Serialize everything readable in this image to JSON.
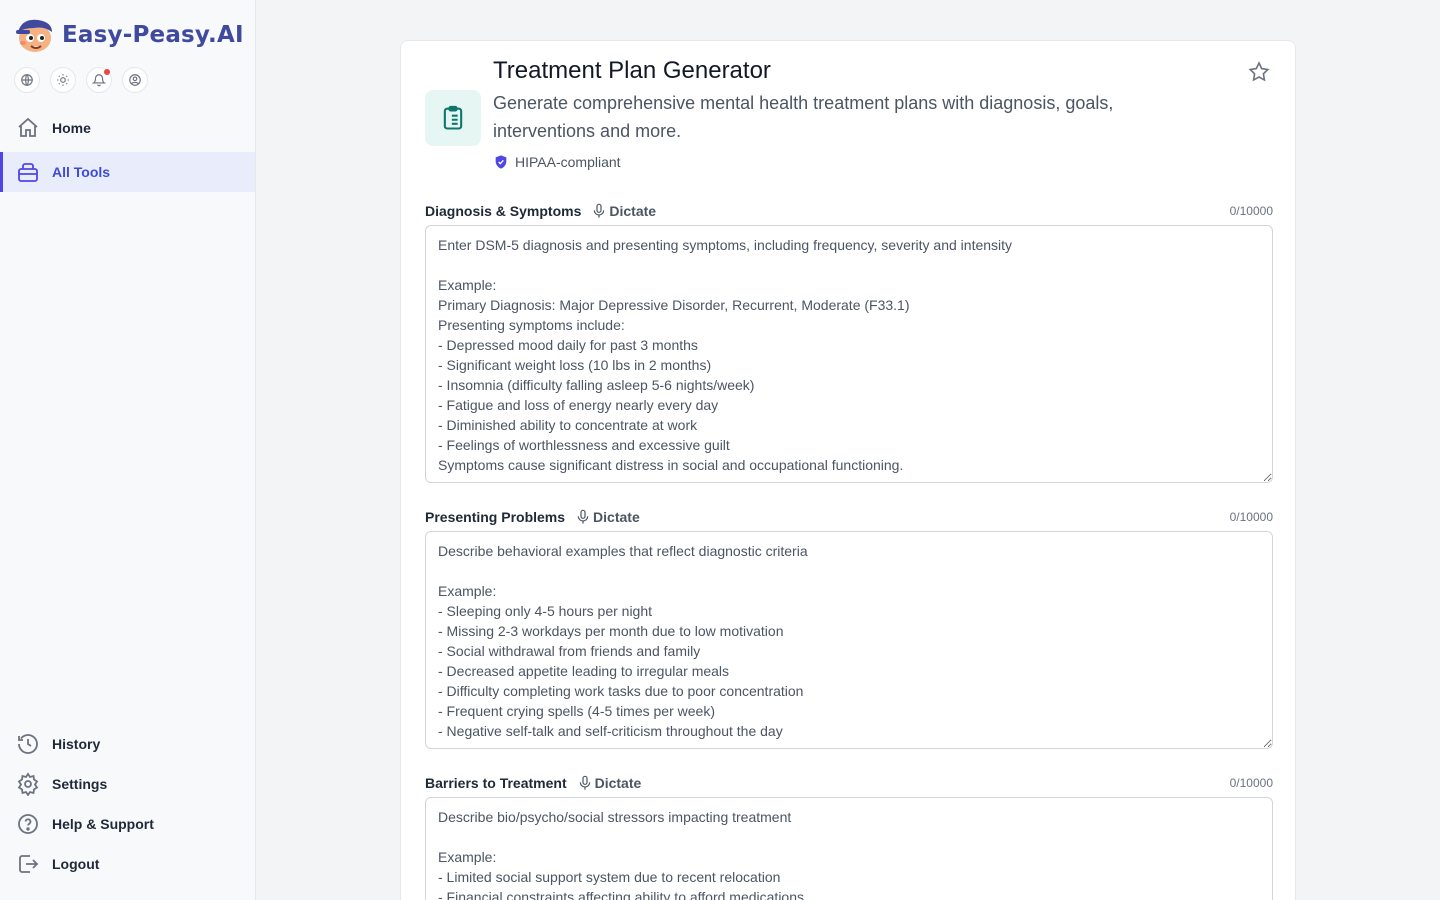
{
  "app": {
    "name": "Easy-Peasy.AI"
  },
  "sidebar": {
    "nav_top": [
      {
        "label": "Home",
        "icon": "home-icon"
      },
      {
        "label": "All Tools",
        "icon": "tools-icon",
        "active": true
      }
    ],
    "nav_bottom": [
      {
        "label": "History",
        "icon": "history-icon"
      },
      {
        "label": "Settings",
        "icon": "gear-icon"
      },
      {
        "label": "Help & Support",
        "icon": "help-icon"
      },
      {
        "label": "Logout",
        "icon": "logout-icon"
      }
    ],
    "quick_icons": [
      "globe-icon",
      "sun-icon",
      "bell-icon",
      "user-circle-icon"
    ],
    "notification_dot": true
  },
  "tool": {
    "title": "Treatment Plan Generator",
    "description": "Generate comprehensive mental health treatment plans with diagnosis, goals, interventions and more.",
    "badge": "HIPAA-compliant",
    "icon": "clipboard-list-icon",
    "favorite_icon": "star-icon"
  },
  "fields": [
    {
      "label": "Diagnosis & Symptoms",
      "dictate_label": "Dictate",
      "counter": "0/10000",
      "value": "",
      "placeholder": "Enter DSM-5 diagnosis and presenting symptoms, including frequency, severity and intensity\n\nExample:\nPrimary Diagnosis: Major Depressive Disorder, Recurrent, Moderate (F33.1)\nPresenting symptoms include:\n- Depressed mood daily for past 3 months\n- Significant weight loss (10 lbs in 2 months)\n- Insomnia (difficulty falling asleep 5-6 nights/week)\n- Fatigue and loss of energy nearly every day\n- Diminished ability to concentrate at work\n- Feelings of worthlessness and excessive guilt\nSymptoms cause significant distress in social and occupational functioning."
    },
    {
      "label": "Presenting Problems",
      "dictate_label": "Dictate",
      "counter": "0/10000",
      "value": "",
      "placeholder": "Describe behavioral examples that reflect diagnostic criteria\n\nExample:\n- Sleeping only 4-5 hours per night\n- Missing 2-3 workdays per month due to low motivation\n- Social withdrawal from friends and family\n- Decreased appetite leading to irregular meals\n- Difficulty completing work tasks due to poor concentration\n- Frequent crying spells (4-5 times per week)\n- Negative self-talk and self-criticism throughout the day"
    },
    {
      "label": "Barriers to Treatment",
      "dictate_label": "Dictate",
      "counter": "0/10000",
      "value": "",
      "placeholder": "Describe bio/psycho/social stressors impacting treatment\n\nExample:\n- Limited social support system due to recent relocation\n- Financial constraints affecting ability to afford medications"
    }
  ],
  "colors": {
    "accent": "#4f46e5",
    "brand_text": "#3f4a9e",
    "tool_icon": "#0f766e",
    "notification": "#ef4444",
    "hipaa_shield": "#4f46e5"
  }
}
